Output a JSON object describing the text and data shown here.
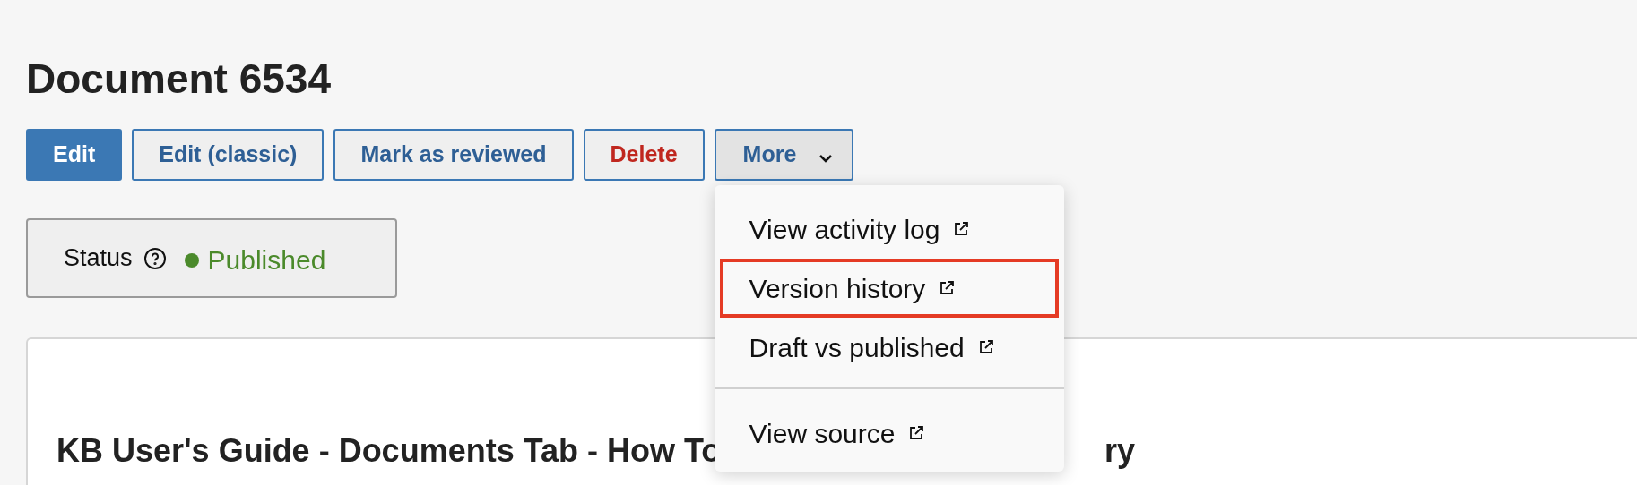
{
  "page_title": "Document 6534",
  "actions": [
    {
      "label": "Edit",
      "kind": "primary"
    },
    {
      "label": "Edit (classic)",
      "kind": "outline"
    },
    {
      "label": "Mark as reviewed",
      "kind": "outline"
    },
    {
      "label": "Delete",
      "kind": "danger"
    },
    {
      "label": "More",
      "kind": "menu",
      "expanded": true
    }
  ],
  "status": {
    "label": "Status",
    "value": "Published",
    "color": "#4b8a2b"
  },
  "more_menu": [
    {
      "label": "View activity log",
      "highlighted": false,
      "divider_before": false
    },
    {
      "label": "Version history",
      "highlighted": true,
      "divider_before": false
    },
    {
      "label": "Draft vs published",
      "highlighted": false,
      "divider_before": false
    },
    {
      "label": "View source",
      "highlighted": false,
      "divider_before": true
    }
  ],
  "card": {
    "heading": "KB User's Guide - Documents Tab - How To",
    "heading_tail": "ry"
  }
}
